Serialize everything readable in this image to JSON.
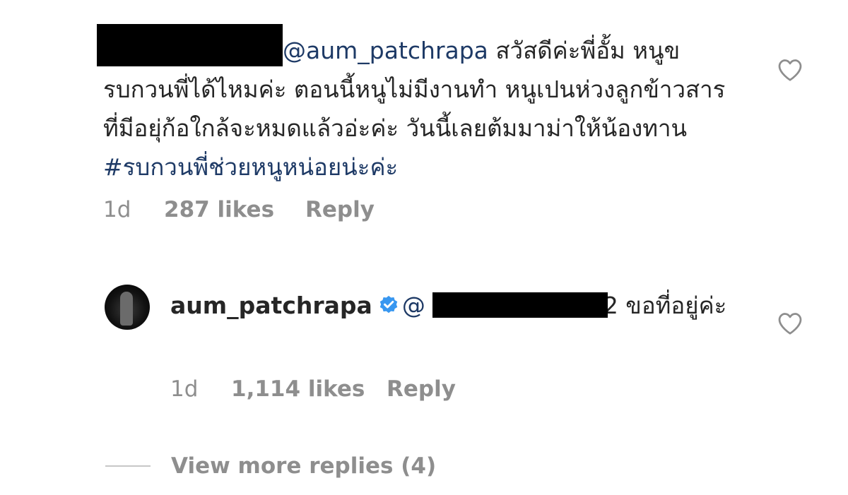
{
  "comment": {
    "mention": "@aum_patchrapa",
    "body": " สวัสดีค่ะพี่อั้ม หนูขรบกวนพี่ได้ไหมค่ะ ตอนนี้หนูไม่มีงานทำ หนูเปนห่วงลูกข้าวสารที่มีอยุ่ก้อใกล้จะหมดแล้วอ่ะค่ะ วันนี้เลยต้มมาม่าให้น้องทาน ",
    "hashtag": "#รบกวนพี่ช่วยหนูหน่อยน่ะค่ะ",
    "time": "1d",
    "likes": "287 likes",
    "reply_label": "Reply",
    "heart_icon": "heart-outline-icon"
  },
  "reply": {
    "username": "aum_patchrapa",
    "verified_icon": "verified-badge-icon",
    "mention_prefix": "@",
    "body": "2 ขอที่อยู่ค่ะ",
    "time": "1d",
    "likes": "1,114 likes",
    "reply_label": "Reply",
    "heart_icon": "heart-outline-icon"
  },
  "view_more": {
    "label": "View more replies (4)"
  },
  "colors": {
    "text": "#262626",
    "muted": "#8e8e8e",
    "link": "#1e3a66",
    "verified": "#3897f0",
    "redaction": "#000000"
  }
}
